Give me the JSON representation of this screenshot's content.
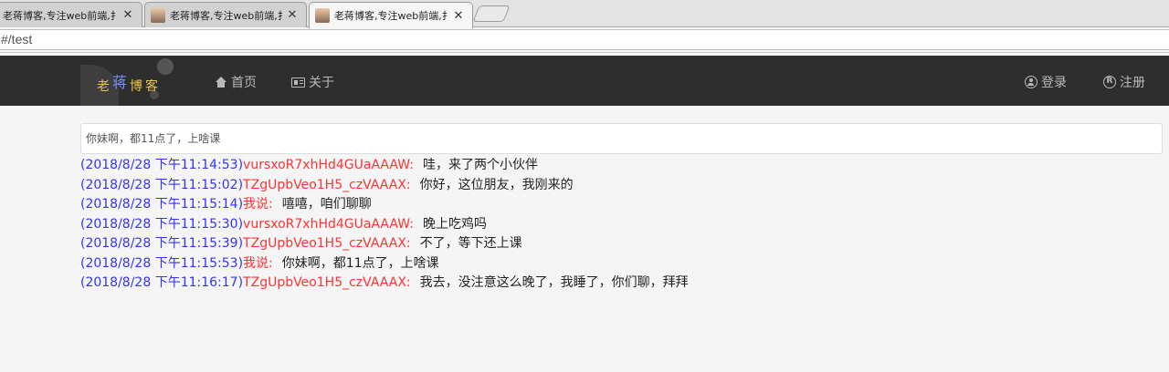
{
  "browser": {
    "tabs": [
      {
        "title": "老蒋博客,专注web前端,扌",
        "active": false
      },
      {
        "title": "老蒋博客,专注web前端,扌",
        "active": false
      },
      {
        "title": "老蒋博客,专注web前端,扌",
        "active": true
      }
    ],
    "close_glyph": "✕",
    "address": "#/test"
  },
  "navbar": {
    "logo": {
      "part1": "老",
      "part2": "蒋",
      "part3": "博客"
    },
    "links": [
      {
        "label": "首页",
        "icon": "home-icon"
      },
      {
        "label": "关于",
        "icon": "id-card-icon"
      }
    ],
    "right_links": [
      {
        "label": "登录",
        "icon": "user-circle-icon"
      },
      {
        "label": "注册",
        "icon": "registered-icon"
      }
    ],
    "registered_glyph": "R"
  },
  "message_input": {
    "value": "你妹啊，都11点了，上啥课"
  },
  "chat": {
    "messages": [
      {
        "time": "(2018/8/28 下午11:14:53)",
        "name": "vursxoR7xhHd4GUaAAAW:",
        "text": "哇，来了两个小伙伴"
      },
      {
        "time": "(2018/8/28 下午11:15:02)",
        "name": "TZgUpbVeo1H5_czVAAAX:",
        "text": "你好，这位朋友，我刚来的"
      },
      {
        "time": "(2018/8/28 下午11:15:14)",
        "name": "我说:",
        "text": "嘻嘻，咱们聊聊"
      },
      {
        "time": "(2018/8/28 下午11:15:30)",
        "name": "vursxoR7xhHd4GUaAAAW:",
        "text": "晚上吃鸡吗"
      },
      {
        "time": "(2018/8/28 下午11:15:39)",
        "name": "TZgUpbVeo1H5_czVAAAX:",
        "text": "不了，等下还上课"
      },
      {
        "time": "(2018/8/28 下午11:15:53)",
        "name": "我说:",
        "text": "你妹啊，都11点了，上啥课"
      },
      {
        "time": "(2018/8/28 下午11:16:17)",
        "name": "TZgUpbVeo1H5_czVAAAX:",
        "text": "我去，没注意这么晚了，我睡了，你们聊，拜拜"
      }
    ]
  }
}
